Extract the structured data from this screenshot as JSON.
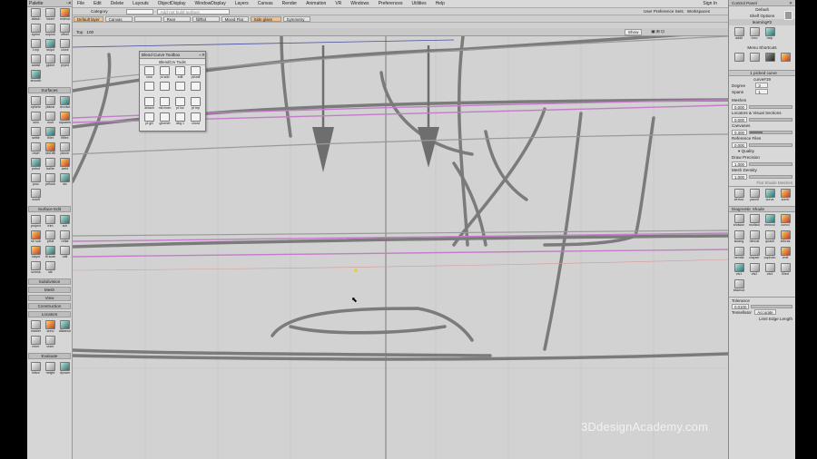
{
  "palette": {
    "title": "Palette",
    "tools_top": [
      "attach",
      "insert",
      "extend",
      "symm",
      "unpick",
      "offset",
      "t-mp",
      "skipd",
      "close",
      "addsit",
      "pjoine",
      "pryed",
      "smooth"
    ],
    "section_surfaces": "Surfaces",
    "tools_surfaces": [
      "sphere",
      "planar",
      "revolve",
      "skin",
      "mult",
      "squares",
      "settle",
      "fillet",
      "filflex",
      "rewrt",
      "rdnDBl",
      "pinner",
      "pnbuf",
      "ballre",
      "weld",
      "proc",
      "prflosh",
      "sfc",
      "xstuff"
    ],
    "section_surface_edit": "Surface Edit",
    "tools_surface_edit": [
      "project",
      "trim",
      "sch",
      "sh sub",
      "pflull",
      "reflat",
      "claynt",
      "fit scan",
      "rdlif",
      "scrnss",
      "stk"
    ],
    "section_subdivision": "Subdivision",
    "section_mesh": "Mesh",
    "section_view": "View",
    "section_construction": "Construction",
    "section_locators": "Locators",
    "tools_locators": [
      "marker",
      "anno",
      "distance",
      "minrr",
      "crsnr"
    ],
    "section_evaluate": "Evaluate",
    "tools_evaluate": [
      "infsnr",
      "height",
      "dynam"
    ]
  },
  "menubar": {
    "items": [
      "File",
      "Edit",
      "Delete",
      "Layouts",
      "ObjectDisplay",
      "WindowDisplay",
      "Layers",
      "Canvas",
      "Render",
      "Animation",
      "VR",
      "Windows",
      "Preferences",
      "Utilities",
      "Help"
    ],
    "sign_in": "Sign In"
  },
  "toolbar": {
    "category_label": "Category",
    "search_placeholder": "Add not build surface",
    "user_pref_sets": "User Preference Sets",
    "workspaces": "Workspaces",
    "default_layer": "Default layer",
    "canvas_label": "Canvas",
    "rear_label": "Rear",
    "tab_fill": "fill/ftid",
    "tab_mixed": "Mixed Flat",
    "side_glass": "Side glass",
    "symmetry": "Symmetry"
  },
  "viewport": {
    "label": "Top",
    "zoom": "100",
    "show_button": "Show"
  },
  "toolbox": {
    "title": "Blend Curve Toolbox",
    "subtitle": "BlendCrv Tools",
    "tools": [
      "new",
      "pt add",
      "edit",
      "pt/unif",
      "",
      "",
      "",
      "",
      "detach",
      "mk mom",
      "pt loc",
      "pt rep",
      "pt gill",
      "geomet",
      "dbg 1",
      "chord"
    ]
  },
  "control_panel": {
    "title": "Control Panel",
    "preset": "Default",
    "shelf_options": "Shelf Options",
    "shelf_name": "learning#2",
    "shelf_tools": [
      "addit",
      "nrev",
      "help"
    ],
    "menu_shortcuts": "Menu Shortcuts",
    "picked": "1 picked curve",
    "curve_name": "curve#19",
    "degree_label": "Degree",
    "degree_value": "3",
    "spans_label": "Spans",
    "spans_value": "1",
    "meshes_label": "Meshes",
    "meshes_value": "0.000",
    "locators_label": "Locators & Visual Sections",
    "locators_value": "0.000",
    "canvases_label": "Canvases",
    "canvases_value": "0.300",
    "ref_label": "Reference Files",
    "ref_value": "0.000",
    "quality_label": "Quality",
    "draw_precision_label": "Draw Precision",
    "draw_precision_value": "1.000",
    "mesh_density_label": "Mesh Density",
    "mesh_density_value": "1.000",
    "flat_shade": "Flat Shade Meshes",
    "shelf2_tools": [
      "zfrmcv",
      "panelf",
      "curva",
      "zomb"
    ],
    "diagnostic_shade": "Diagnostic Shade",
    "diag_tools": [
      "shdwon",
      "multicol",
      "mnncol",
      "curvcl",
      "isoang",
      "hlmnat",
      "quasit",
      "zebras",
      "hemfal",
      "clayser",
      "cophoto",
      "vmtl",
      "vis1",
      "vis2",
      "vis3",
      "filled",
      "bssmod"
    ],
    "tolerance_label": "Tolerance",
    "tolerance_value": "0.0100",
    "tessellator_label": "Tessellator",
    "tessellator_value": "Accurate",
    "limit_edge": "Limit Edge Length"
  },
  "watermark": "3DdesignAcademy.com"
}
